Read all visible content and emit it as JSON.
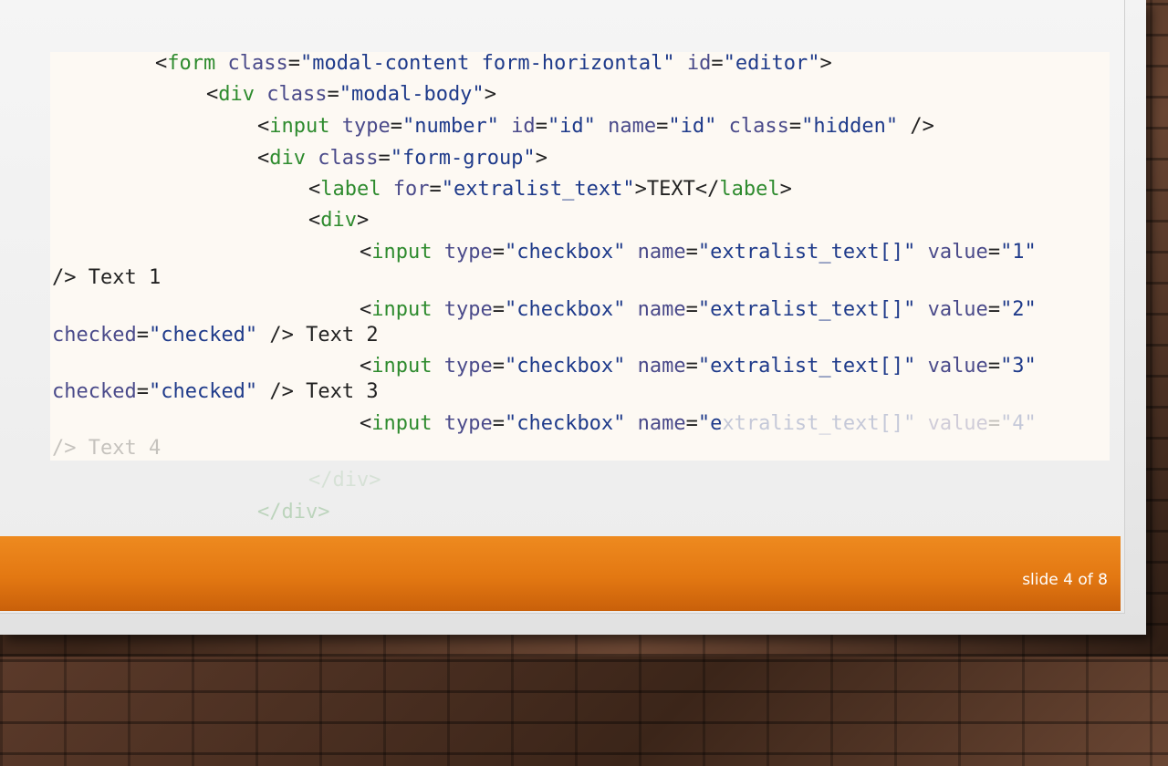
{
  "code": {
    "l1": {
      "lt": "<",
      "tag": "form",
      "a1": " class",
      "eq1": "=",
      "v1": "\"modal-content form-horizontal\"",
      "a2": " id",
      "eq2": "=",
      "v2": "\"editor\"",
      "gt": ">"
    },
    "l2": {
      "lt": "<",
      "tag": "div",
      "a1": " class",
      "eq1": "=",
      "v1": "\"modal-body\"",
      "gt": ">"
    },
    "l3": {
      "lt": "<",
      "tag": "input",
      "a1": " type",
      "eq1": "=",
      "v1": "\"number\"",
      "a2": " id",
      "eq2": "=",
      "v2": "\"id\"",
      "a3": " name",
      "eq3": "=",
      "v3": "\"id\"",
      "a4": " class",
      "eq4": "=",
      "v4": "\"hidden\"",
      "end": " />"
    },
    "l4": {
      "lt": "<",
      "tag": "div",
      "a1": " class",
      "eq1": "=",
      "v1": "\"form-group\"",
      "gt": ">"
    },
    "l5": {
      "lt": "<",
      "tag": "label",
      "a1": " for",
      "eq1": "=",
      "v1": "\"extralist_text\"",
      "gt": ">",
      "text": "TEXT",
      "close_lt": "</",
      "close_tag": "label",
      "close_gt": ">"
    },
    "l6": {
      "lt": "<",
      "tag": "div",
      "gt": ">"
    },
    "l7": {
      "lt": "<",
      "tag": "input",
      "a1": " type",
      "eq1": "=",
      "v1": "\"checkbox\"",
      "a2": " name",
      "eq2": "=",
      "v2": "\"extralist_text[]\"",
      "a3": " value",
      "eq3": "=",
      "v3": "\"1\""
    },
    "l7b": {
      "end": "/> Text 1"
    },
    "l8": {
      "lt": "<",
      "tag": "input",
      "a1": " type",
      "eq1": "=",
      "v1": "\"checkbox\"",
      "a2": " name",
      "eq2": "=",
      "v2": "\"extralist_text[]\"",
      "a3": " value",
      "eq3": "=",
      "v3": "\"2\""
    },
    "l8b": {
      "a": "checked",
      "eq": "=",
      "v": "\"checked\"",
      "end": " /> Text 2"
    },
    "l9": {
      "lt": "<",
      "tag": "input",
      "a1": " type",
      "eq1": "=",
      "v1": "\"checkbox\"",
      "a2": " name",
      "eq2": "=",
      "v2": "\"extralist_text[]\"",
      "a3": " value",
      "eq3": "=",
      "v3": "\"3\""
    },
    "l9b": {
      "a": "checked",
      "eq": "=",
      "v": "\"checked\"",
      "end": " /> Text 3"
    },
    "l10": {
      "lt": "<",
      "tag": "input",
      "a1": " type",
      "eq1": "=",
      "v1": "\"checkbox\"",
      "a2": " name",
      "eq2": "=",
      "v2a": "\"e",
      "v2b": "xtralist_text[]\"",
      "a3": " value",
      "eq3": "=",
      "v3": "\"4\""
    },
    "l10b": {
      "end": "/> Text 4"
    },
    "l11": {
      "text": "</div>"
    },
    "l12": {
      "text": "</div>"
    }
  },
  "footer": {
    "slide_number": "slide 4 of 8"
  },
  "colors": {
    "accent": "#e37812",
    "tag": "#2e8b2e",
    "attr": "#4a4a8a",
    "string": "#1e3a8a"
  }
}
